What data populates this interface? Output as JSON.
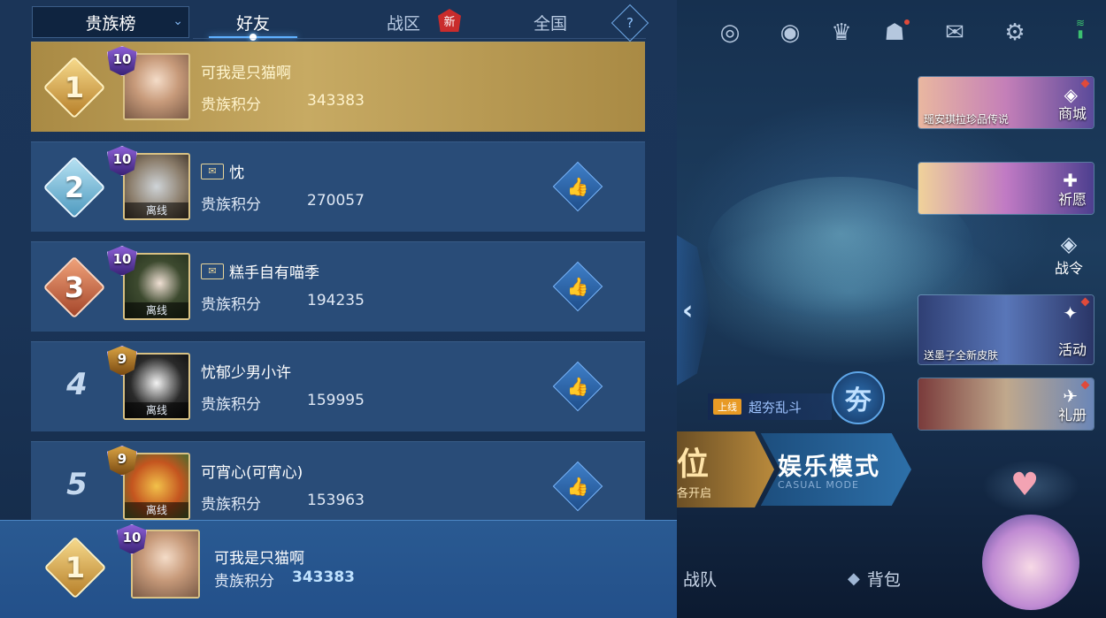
{
  "header": {
    "dropdown_label": "贵族榜",
    "tabs": [
      {
        "label": "好友",
        "active": true
      },
      {
        "label": "战区",
        "badge": "新"
      },
      {
        "label": "全国"
      }
    ],
    "help_icon": "?"
  },
  "leaderboard": {
    "score_label": "贵族积分",
    "rows": [
      {
        "rank": "1",
        "noble_level": "10",
        "name": "可我是只猫啊",
        "score": "343383",
        "offline": false
      },
      {
        "rank": "2",
        "noble_level": "10",
        "name": "忱",
        "score": "270057",
        "offline": true,
        "offline_label": "离线"
      },
      {
        "rank": "3",
        "noble_level": "10",
        "name": "糕手自有喵季",
        "score": "194235",
        "offline": true,
        "offline_label": "离线"
      },
      {
        "rank": "4",
        "noble_level": "9",
        "name": "忧郁少男小许",
        "score": "159995",
        "offline": true,
        "offline_label": "离线"
      },
      {
        "rank": "5",
        "noble_level": "9",
        "name": "可宵心(可宵心)",
        "score": "153963",
        "offline": true,
        "offline_label": "离线"
      }
    ]
  },
  "my_rank": {
    "rank": "1",
    "noble_level": "10",
    "name": "可我是只猫啊",
    "score_label": "贵族积分",
    "score": "343383"
  },
  "side_menu": {
    "cards": [
      {
        "caption": "瑶安琪拉珍品传说",
        "label": "商城"
      },
      {
        "caption": "",
        "label": "祈愿"
      },
      {
        "caption": "送墨子全新皮肤",
        "label": "活动"
      },
      {
        "caption": "",
        "label": "礼册"
      }
    ],
    "battle_pass_label": "战令"
  },
  "modes": {
    "rank_big": "位",
    "rank_sub": "各开启",
    "casual_big": "娱乐模式",
    "casual_sub": "CASUAL MODE",
    "event_tag": "上线",
    "event_text": "超夯乱斗",
    "event_badge": "夯"
  },
  "bottom_nav": {
    "team_label": "战队",
    "bag_label": "背包"
  },
  "icons": {
    "top": [
      "target-icon",
      "eye-icon",
      "trophy-icon",
      "friends-icon",
      "mail-icon",
      "settings-icon"
    ]
  }
}
